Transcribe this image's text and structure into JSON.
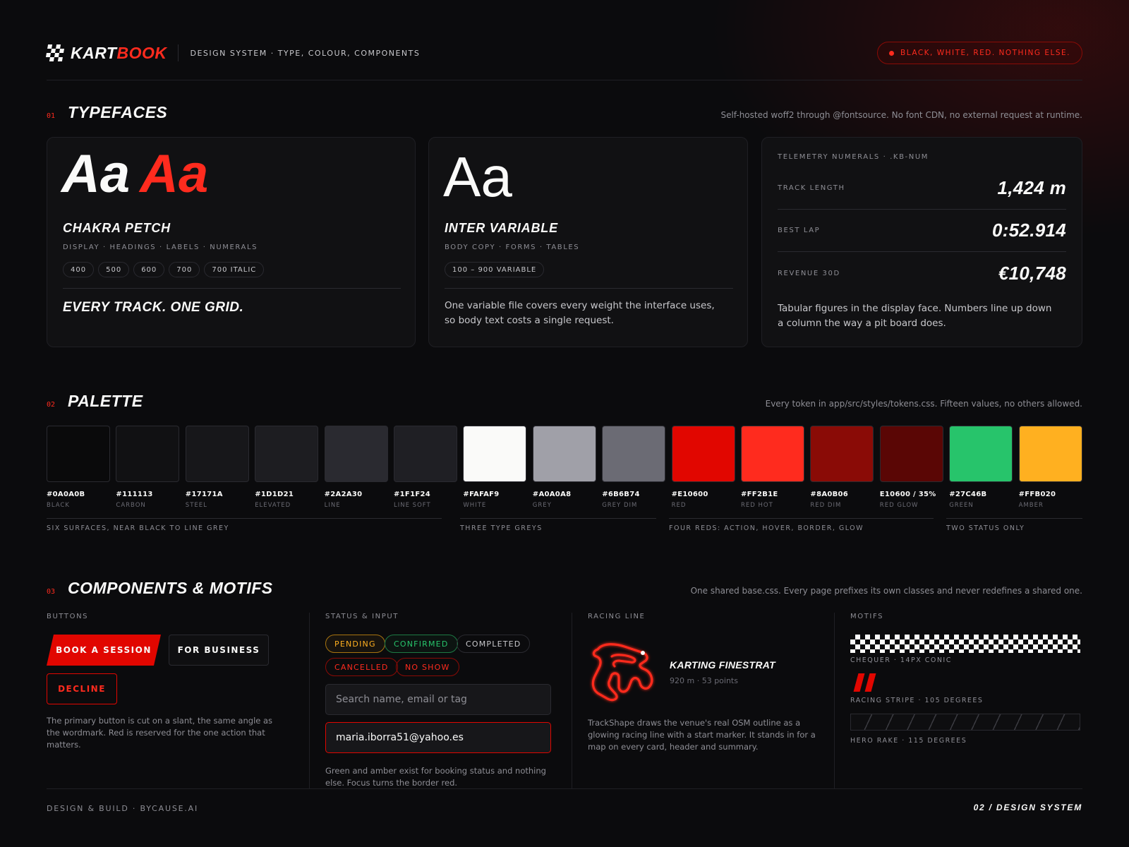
{
  "header": {
    "brand_part1": "KART",
    "brand_part2": "BOOK",
    "subtitle": "DESIGN SYSTEM · TYPE, COLOUR, COMPONENTS",
    "motto": "BLACK, WHITE, RED. NOTHING ELSE.",
    "logo_icon": "checkered-flag-icon"
  },
  "sections": {
    "typefaces": {
      "num": "01",
      "title": "TYPEFACES",
      "note": "Self-hosted woff2 through @fontsource. No font CDN, no external request at runtime."
    },
    "palette": {
      "num": "02",
      "title": "PALETTE",
      "note": "Every token in app/src/styles/tokens.css. Fifteen values, no others allowed."
    },
    "components": {
      "num": "03",
      "title": "COMPONENTS & MOTIFS",
      "note": "One shared base.css. Every page prefixes its own classes and never redefines a shared one."
    }
  },
  "type_cards": {
    "chakra": {
      "glyph_white": "Aa",
      "glyph_red": "Aa",
      "name": "CHAKRA PETCH",
      "usage": "DISPLAY · HEADINGS · LABELS · NUMERALS",
      "weights": [
        "400",
        "500",
        "600",
        "700",
        "700 ITALIC"
      ],
      "tagline": "EVERY TRACK. ONE GRID."
    },
    "inter": {
      "glyph": "Aa",
      "name": "INTER VARIABLE",
      "usage": "BODY COPY · FORMS · TABLES",
      "weights": [
        "100 – 900 VARIABLE"
      ],
      "body": "One variable file covers every weight the interface uses, so body text costs a single request."
    },
    "telemetry": {
      "heading": "TELEMETRY NUMERALS · .KB-NUM",
      "rows": [
        {
          "label": "TRACK LENGTH",
          "value": "1,424 m"
        },
        {
          "label": "BEST LAP",
          "value": "0:52.914"
        },
        {
          "label": "REVENUE 30D",
          "value": "€10,748"
        }
      ],
      "body": "Tabular figures in the display face. Numbers line up down a column the way a pit board does."
    }
  },
  "palette": {
    "swatches": [
      {
        "hex": "#0A0A0B",
        "name": "BLACK",
        "color": "#0A0A0B"
      },
      {
        "hex": "#111113",
        "name": "CARBON",
        "color": "#111113"
      },
      {
        "hex": "#17171A",
        "name": "STEEL",
        "color": "#17171A"
      },
      {
        "hex": "#1D1D21",
        "name": "ELEVATED",
        "color": "#1D1D21"
      },
      {
        "hex": "#2A2A30",
        "name": "LINE",
        "color": "#2A2A30"
      },
      {
        "hex": "#1F1F24",
        "name": "LINE SOFT",
        "color": "#1F1F24"
      },
      {
        "hex": "#FAFAF9",
        "name": "WHITE",
        "color": "#FAFAF9"
      },
      {
        "hex": "#A0A0A8",
        "name": "GREY",
        "color": "#A0A0A8"
      },
      {
        "hex": "#6B6B74",
        "name": "GREY DIM",
        "color": "#6B6B74"
      },
      {
        "hex": "#E10600",
        "name": "RED",
        "color": "#E10600"
      },
      {
        "hex": "#FF2B1E",
        "name": "RED HOT",
        "color": "#FF2B1E"
      },
      {
        "hex": "#8A0B06",
        "name": "RED DIM",
        "color": "#8A0B06"
      },
      {
        "hex": "E10600 / 35%",
        "name": "RED GLOW",
        "color": "#5A0605"
      },
      {
        "hex": "#27C46B",
        "name": "GREEN",
        "color": "#27C46B"
      },
      {
        "hex": "#FFB020",
        "name": "AMBER",
        "color": "#FFB020"
      }
    ],
    "groups": [
      "SIX SURFACES, NEAR BLACK TO LINE GREY",
      "THREE TYPE GREYS",
      "FOUR REDS: ACTION, HOVER, BORDER, GLOW",
      "TWO STATUS ONLY"
    ]
  },
  "components": {
    "buttons": {
      "label": "BUTTONS",
      "primary": "BOOK A SESSION",
      "secondary": "FOR BUSINESS",
      "decline": "DECLINE",
      "note": "The primary button is cut on a slant, the same angle as the wordmark. Red is reserved for the one action that matters."
    },
    "status": {
      "label": "STATUS & INPUT",
      "badges": {
        "pending": "PENDING",
        "confirmed": "CONFIRMED",
        "completed": "COMPLETED",
        "cancelled": "CANCELLED",
        "no_show": "NO SHOW"
      },
      "search_placeholder": "Search name, email or tag",
      "email_value": "maria.iborra51@yahoo.es",
      "note": "Green and amber exist for booking status and nothing else. Focus turns the border red."
    },
    "racing": {
      "label": "RACING LINE",
      "track_name": "KARTING FINESTRAT",
      "track_meta": "920 m · 53 points",
      "note": "TrackShape draws the venue's real OSM outline as a glowing racing line with a start marker. It stands in for a map on every card, header and summary."
    },
    "motifs": {
      "label": "MOTIFS",
      "chequer": "CHEQUER · 14PX CONIC",
      "stripe": "RACING STRIPE · 105 DEGREES",
      "rake": "HERO RAKE · 115 DEGREES"
    }
  },
  "footer": {
    "left": "DESIGN & BUILD · BYCAUSE.AI",
    "right": "02 / DESIGN SYSTEM"
  },
  "colors": {
    "accent": "#E10600",
    "accent_hot": "#FF2B1E",
    "background": "#0A0A0B"
  }
}
